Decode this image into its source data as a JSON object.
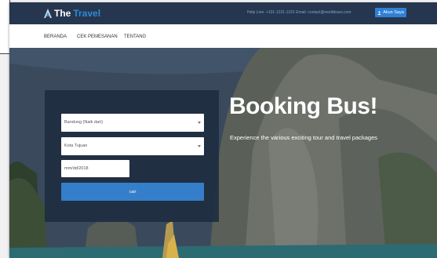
{
  "brand": {
    "name_part1": "The",
    "name_part2": "Travel"
  },
  "topbar": {
    "contact": "Help Line: +101-1231-1231  Email: contact@worldtours.com",
    "account_button": "Akun Saya"
  },
  "nav": {
    "items": [
      "BERANDA",
      "CEK PEMESANAN",
      "TENTANG"
    ]
  },
  "booking": {
    "origin_placeholder": "Bandung (Naik dari)",
    "destination_placeholder": "Kota Tujuan",
    "date_value": "mm/dd/2018",
    "search_button": "cari"
  },
  "hero": {
    "title": "Booking Bus!",
    "subtitle": "Experience the various exciting tour and travel packages"
  },
  "colors": {
    "topbar_bg": "#25364e",
    "brand_accent": "#2e8bdc",
    "button_blue": "#357ec9",
    "panel_bg": "#202e42"
  },
  "icons": [
    "logo-icon",
    "user-icon",
    "chevron-down-icon"
  ]
}
